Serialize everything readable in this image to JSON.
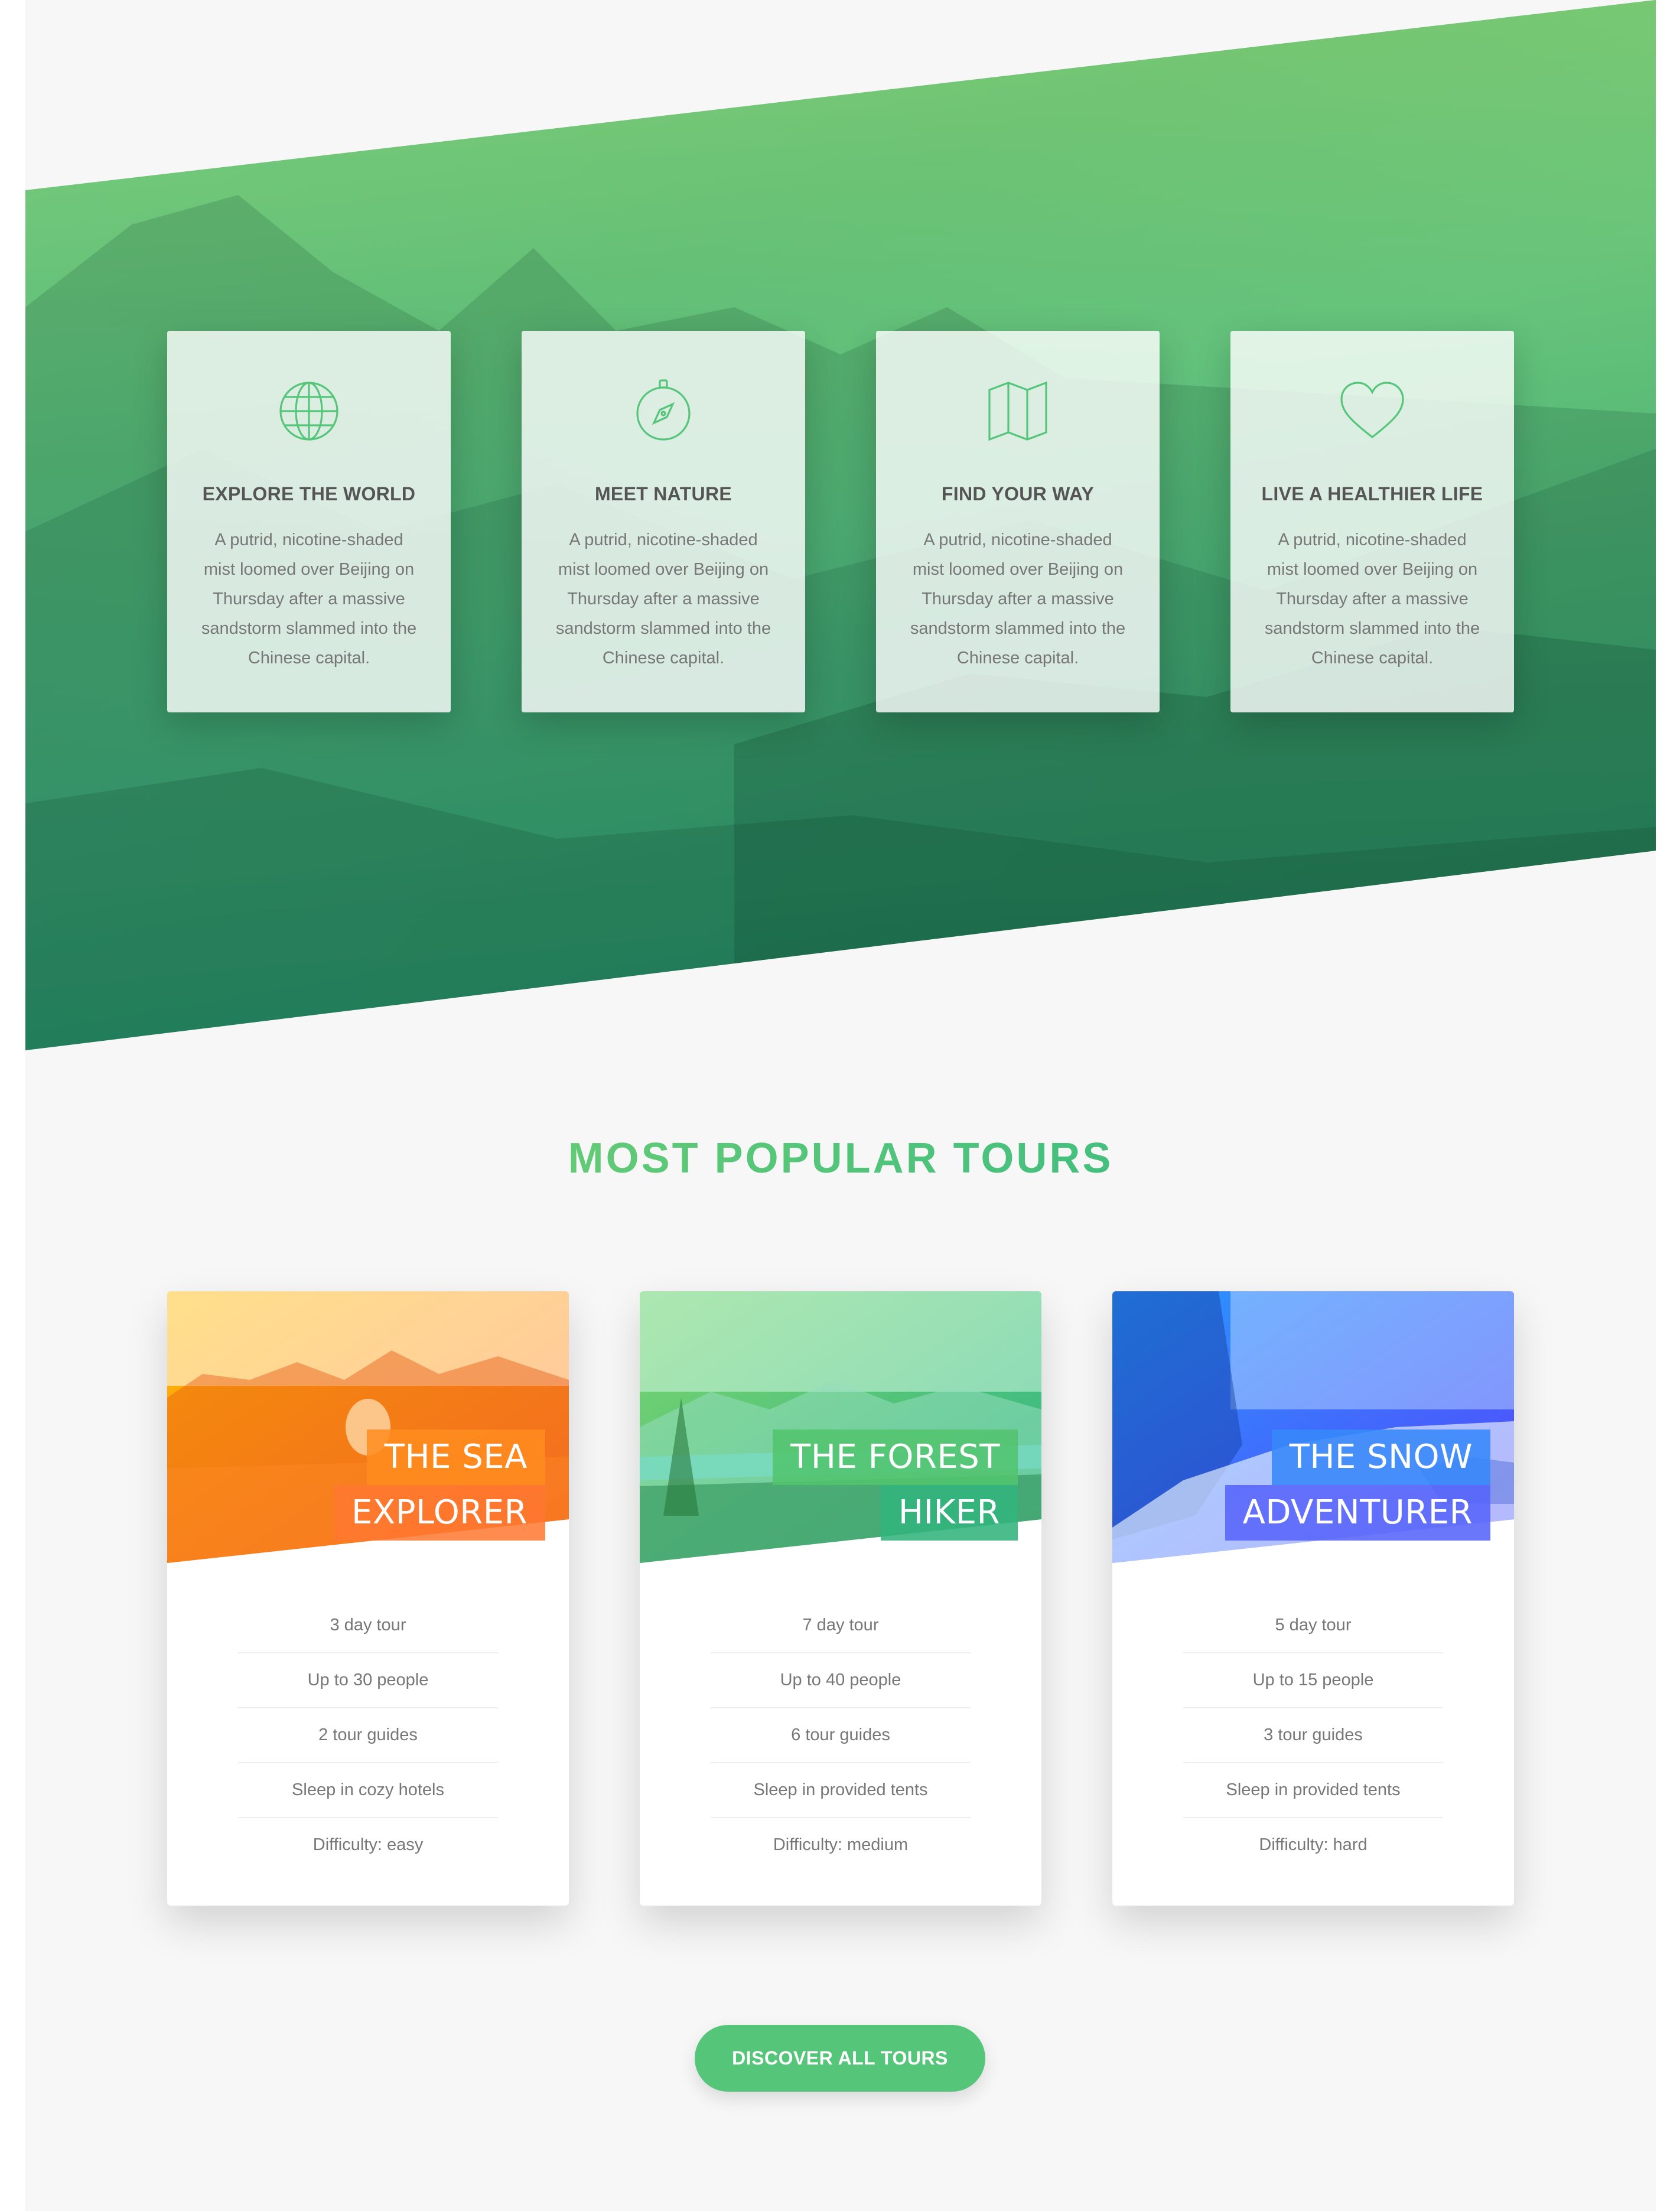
{
  "features": [
    {
      "icon": "globe-icon",
      "title": "EXPLORE THE WORLD",
      "text": "A putrid, nicotine-shaded mist loomed over Beijing on Thursday after a massive sandstorm slammed into the Chinese capital."
    },
    {
      "icon": "compass-icon",
      "title": "MEET NATURE",
      "text": "A putrid, nicotine-shaded mist loomed over Beijing on Thursday after a massive sandstorm slammed into the Chinese capital."
    },
    {
      "icon": "map-icon",
      "title": "FIND YOUR WAY",
      "text": "A putrid, nicotine-shaded mist loomed over Beijing on Thursday after a massive sandstorm slammed into the Chinese capital."
    },
    {
      "icon": "heart-icon",
      "title": "LIVE A HEALTHIER LIFE",
      "text": "A putrid, nicotine-shaded mist loomed over Beijing on Thursday after a massive sandstorm slammed into the Chinese capital."
    }
  ],
  "tours_section": {
    "title": "MOST POPULAR TOURS"
  },
  "tours": [
    {
      "heading_line1": "THE SEA",
      "heading_line2": "EXPLORER",
      "color_start": "#ffb900",
      "color_end": "#ff7730",
      "details": [
        "3 day tour",
        "Up to 30 people",
        "2 tour guides",
        "Sleep in cozy hotels",
        "Difficulty: easy"
      ]
    },
    {
      "heading_line1": "THE FOREST",
      "heading_line2": "HIKER",
      "color_start": "#7ed56f",
      "color_end": "#28b485",
      "details": [
        "7 day tour",
        "Up to 40 people",
        "6 tour guides",
        "Sleep in provided tents",
        "Difficulty: medium"
      ]
    },
    {
      "heading_line1": "THE SNOW",
      "heading_line2": "ADVENTURER",
      "color_start": "#2998ff",
      "color_end": "#5643fa",
      "details": [
        "5 day tour",
        "Up to 15 people",
        "3 tour guides",
        "Sleep in provided tents",
        "Difficulty: hard"
      ]
    }
  ],
  "cta": {
    "label": "DISCOVER ALL TOURS"
  },
  "colors": {
    "primary": "#55c57a",
    "primary_light": "#7ed56f",
    "primary_dark": "#28b485",
    "background": "#f7f7f7"
  }
}
